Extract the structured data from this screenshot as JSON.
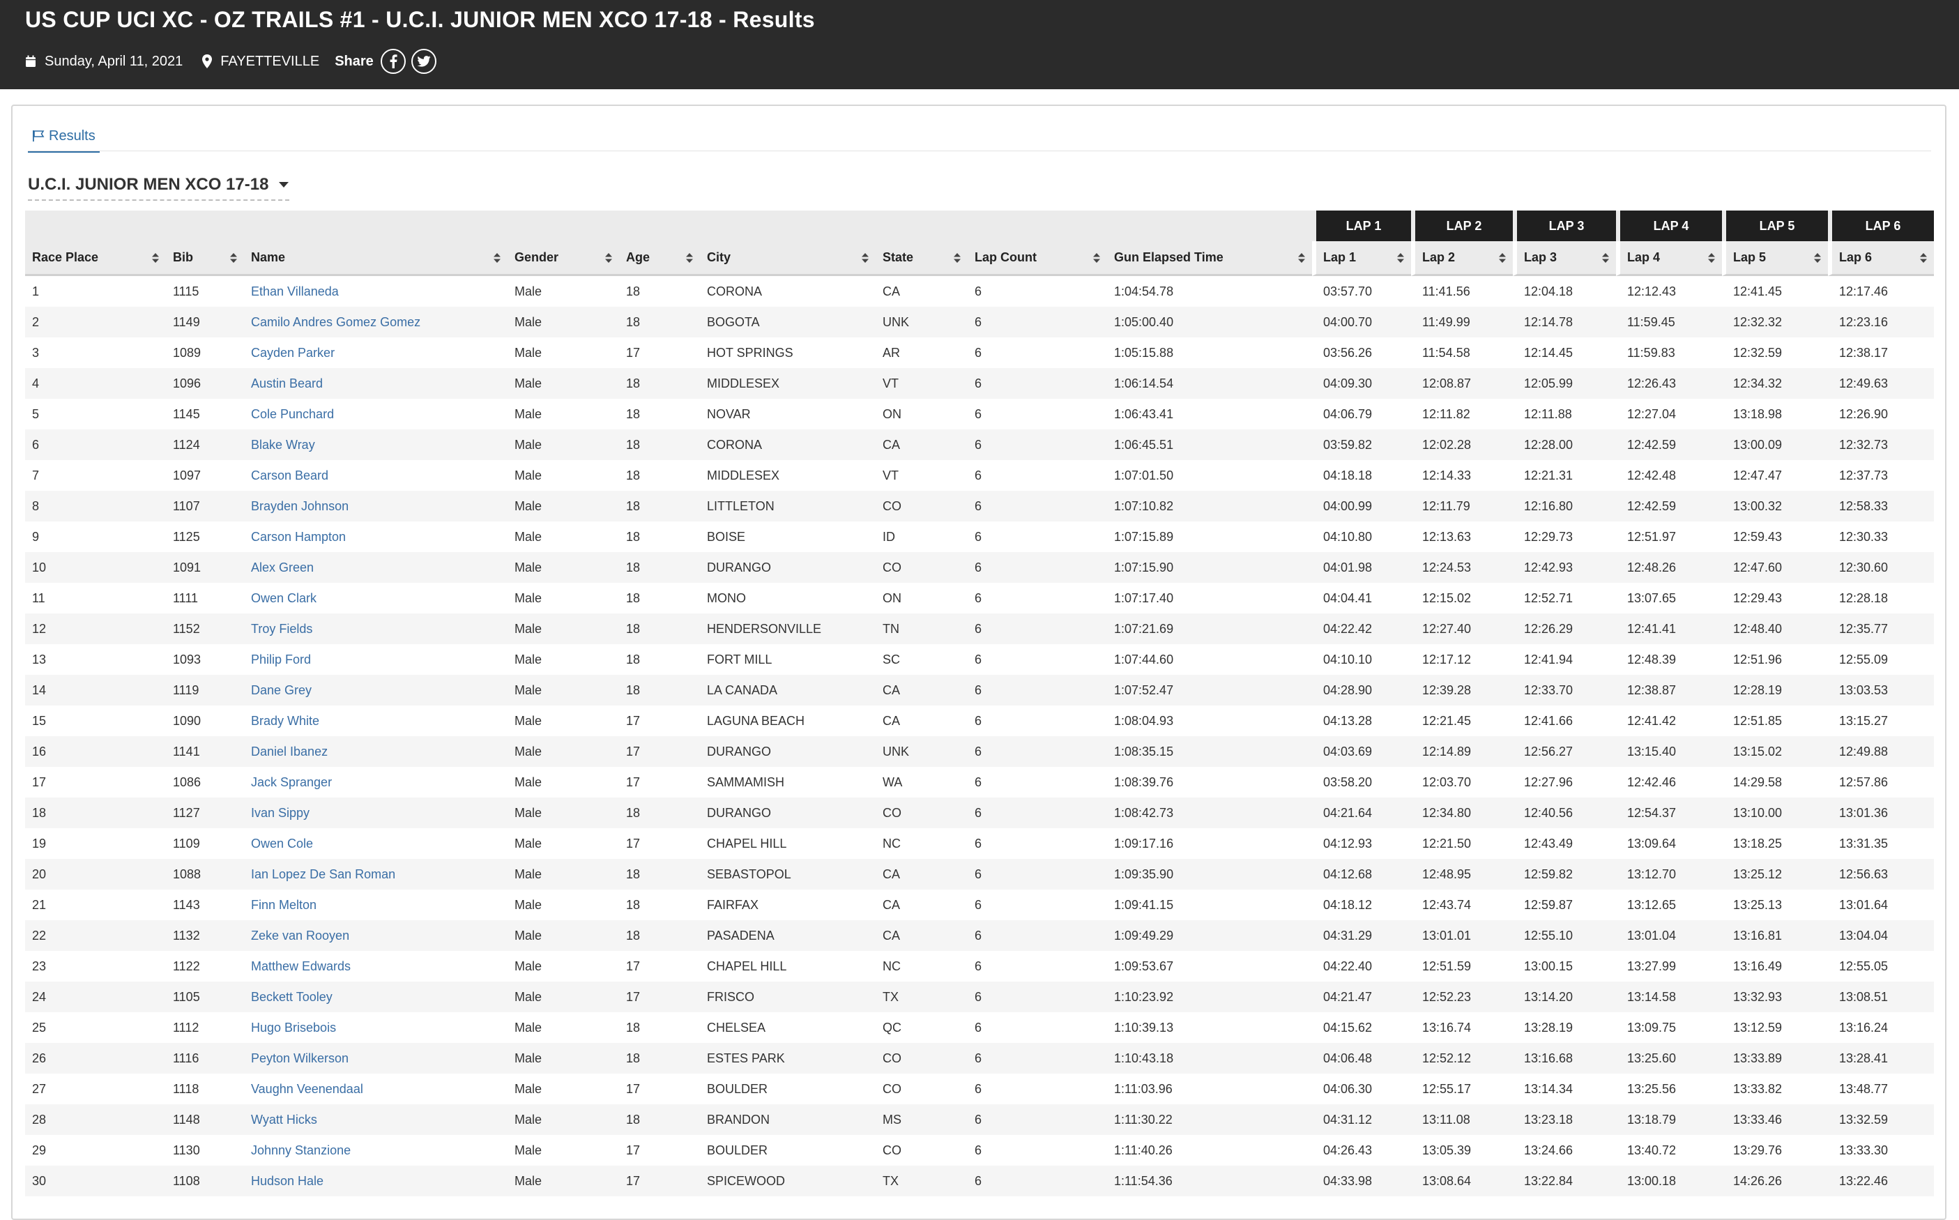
{
  "header": {
    "title": "US CUP UCI XC - OZ TRAILS #1 - U.C.I. JUNIOR MEN XCO 17-18 - Results",
    "date": "Sunday, April 11, 2021",
    "location": "FAYETTEVILLE",
    "share_label": "Share"
  },
  "tabs": [
    {
      "label": "Results"
    }
  ],
  "category": {
    "selected": "U.C.I. JUNIOR MEN XCO 17-18"
  },
  "table": {
    "lap_groups": [
      "LAP 1",
      "LAP 2",
      "LAP 3",
      "LAP 4",
      "LAP 5",
      "LAP 6"
    ],
    "columns": [
      "Race Place",
      "Bib",
      "Name",
      "Gender",
      "Age",
      "City",
      "State",
      "Lap Count",
      "Gun Elapsed Time",
      "Lap 1",
      "Lap 2",
      "Lap 3",
      "Lap 4",
      "Lap 5",
      "Lap 6"
    ],
    "rows": [
      [
        "1",
        "1115",
        "Ethan Villaneda",
        "Male",
        "18",
        "CORONA",
        "CA",
        "6",
        "1:04:54.78",
        "03:57.70",
        "11:41.56",
        "12:04.18",
        "12:12.43",
        "12:41.45",
        "12:17.46"
      ],
      [
        "2",
        "1149",
        "Camilo Andres Gomez Gomez",
        "Male",
        "18",
        "BOGOTA",
        "UNK",
        "6",
        "1:05:00.40",
        "04:00.70",
        "11:49.99",
        "12:14.78",
        "11:59.45",
        "12:32.32",
        "12:23.16"
      ],
      [
        "3",
        "1089",
        "Cayden Parker",
        "Male",
        "17",
        "HOT SPRINGS",
        "AR",
        "6",
        "1:05:15.88",
        "03:56.26",
        "11:54.58",
        "12:14.45",
        "11:59.83",
        "12:32.59",
        "12:38.17"
      ],
      [
        "4",
        "1096",
        "Austin Beard",
        "Male",
        "18",
        "MIDDLESEX",
        "VT",
        "6",
        "1:06:14.54",
        "04:09.30",
        "12:08.87",
        "12:05.99",
        "12:26.43",
        "12:34.32",
        "12:49.63"
      ],
      [
        "5",
        "1145",
        "Cole Punchard",
        "Male",
        "18",
        "NOVAR",
        "ON",
        "6",
        "1:06:43.41",
        "04:06.79",
        "12:11.82",
        "12:11.88",
        "12:27.04",
        "13:18.98",
        "12:26.90"
      ],
      [
        "6",
        "1124",
        "Blake Wray",
        "Male",
        "18",
        "CORONA",
        "CA",
        "6",
        "1:06:45.51",
        "03:59.82",
        "12:02.28",
        "12:28.00",
        "12:42.59",
        "13:00.09",
        "12:32.73"
      ],
      [
        "7",
        "1097",
        "Carson Beard",
        "Male",
        "18",
        "MIDDLESEX",
        "VT",
        "6",
        "1:07:01.50",
        "04:18.18",
        "12:14.33",
        "12:21.31",
        "12:42.48",
        "12:47.47",
        "12:37.73"
      ],
      [
        "8",
        "1107",
        "Brayden Johnson",
        "Male",
        "18",
        "LITTLETON",
        "CO",
        "6",
        "1:07:10.82",
        "04:00.99",
        "12:11.79",
        "12:16.80",
        "12:42.59",
        "13:00.32",
        "12:58.33"
      ],
      [
        "9",
        "1125",
        "Carson Hampton",
        "Male",
        "18",
        "BOISE",
        "ID",
        "6",
        "1:07:15.89",
        "04:10.80",
        "12:13.63",
        "12:29.73",
        "12:51.97",
        "12:59.43",
        "12:30.33"
      ],
      [
        "10",
        "1091",
        "Alex Green",
        "Male",
        "18",
        "DURANGO",
        "CO",
        "6",
        "1:07:15.90",
        "04:01.98",
        "12:24.53",
        "12:42.93",
        "12:48.26",
        "12:47.60",
        "12:30.60"
      ],
      [
        "11",
        "1111",
        "Owen Clark",
        "Male",
        "18",
        "MONO",
        "ON",
        "6",
        "1:07:17.40",
        "04:04.41",
        "12:15.02",
        "12:52.71",
        "13:07.65",
        "12:29.43",
        "12:28.18"
      ],
      [
        "12",
        "1152",
        "Troy Fields",
        "Male",
        "18",
        "HENDERSONVILLE",
        "TN",
        "6",
        "1:07:21.69",
        "04:22.42",
        "12:27.40",
        "12:26.29",
        "12:41.41",
        "12:48.40",
        "12:35.77"
      ],
      [
        "13",
        "1093",
        "Philip Ford",
        "Male",
        "18",
        "FORT MILL",
        "SC",
        "6",
        "1:07:44.60",
        "04:10.10",
        "12:17.12",
        "12:41.94",
        "12:48.39",
        "12:51.96",
        "12:55.09"
      ],
      [
        "14",
        "1119",
        "Dane Grey",
        "Male",
        "18",
        "LA CANADA",
        "CA",
        "6",
        "1:07:52.47",
        "04:28.90",
        "12:39.28",
        "12:33.70",
        "12:38.87",
        "12:28.19",
        "13:03.53"
      ],
      [
        "15",
        "1090",
        "Brady White",
        "Male",
        "17",
        "LAGUNA BEACH",
        "CA",
        "6",
        "1:08:04.93",
        "04:13.28",
        "12:21.45",
        "12:41.66",
        "12:41.42",
        "12:51.85",
        "13:15.27"
      ],
      [
        "16",
        "1141",
        "Daniel Ibanez",
        "Male",
        "17",
        "DURANGO",
        "UNK",
        "6",
        "1:08:35.15",
        "04:03.69",
        "12:14.89",
        "12:56.27",
        "13:15.40",
        "13:15.02",
        "12:49.88"
      ],
      [
        "17",
        "1086",
        "Jack Spranger",
        "Male",
        "17",
        "SAMMAMISH",
        "WA",
        "6",
        "1:08:39.76",
        "03:58.20",
        "12:03.70",
        "12:27.96",
        "12:42.46",
        "14:29.58",
        "12:57.86"
      ],
      [
        "18",
        "1127",
        "Ivan Sippy",
        "Male",
        "18",
        "DURANGO",
        "CO",
        "6",
        "1:08:42.73",
        "04:21.64",
        "12:34.80",
        "12:40.56",
        "12:54.37",
        "13:10.00",
        "13:01.36"
      ],
      [
        "19",
        "1109",
        "Owen Cole",
        "Male",
        "17",
        "CHAPEL HILL",
        "NC",
        "6",
        "1:09:17.16",
        "04:12.93",
        "12:21.50",
        "12:43.49",
        "13:09.64",
        "13:18.25",
        "13:31.35"
      ],
      [
        "20",
        "1088",
        "Ian Lopez De San Roman",
        "Male",
        "18",
        "SEBASTOPOL",
        "CA",
        "6",
        "1:09:35.90",
        "04:12.68",
        "12:48.95",
        "12:59.82",
        "13:12.70",
        "13:25.12",
        "12:56.63"
      ],
      [
        "21",
        "1143",
        "Finn Melton",
        "Male",
        "18",
        "FAIRFAX",
        "CA",
        "6",
        "1:09:41.15",
        "04:18.12",
        "12:43.74",
        "12:59.87",
        "13:12.65",
        "13:25.13",
        "13:01.64"
      ],
      [
        "22",
        "1132",
        "Zeke van Rooyen",
        "Male",
        "18",
        "PASADENA",
        "CA",
        "6",
        "1:09:49.29",
        "04:31.29",
        "13:01.01",
        "12:55.10",
        "13:01.04",
        "13:16.81",
        "13:04.04"
      ],
      [
        "23",
        "1122",
        "Matthew Edwards",
        "Male",
        "17",
        "CHAPEL HILL",
        "NC",
        "6",
        "1:09:53.67",
        "04:22.40",
        "12:51.59",
        "13:00.15",
        "13:27.99",
        "13:16.49",
        "12:55.05"
      ],
      [
        "24",
        "1105",
        "Beckett Tooley",
        "Male",
        "17",
        "FRISCO",
        "TX",
        "6",
        "1:10:23.92",
        "04:21.47",
        "12:52.23",
        "13:14.20",
        "13:14.58",
        "13:32.93",
        "13:08.51"
      ],
      [
        "25",
        "1112",
        "Hugo Brisebois",
        "Male",
        "18",
        "CHELSEA",
        "QC",
        "6",
        "1:10:39.13",
        "04:15.62",
        "13:16.74",
        "13:28.19",
        "13:09.75",
        "13:12.59",
        "13:16.24"
      ],
      [
        "26",
        "1116",
        "Peyton Wilkerson",
        "Male",
        "18",
        "ESTES PARK",
        "CO",
        "6",
        "1:10:43.18",
        "04:06.48",
        "12:52.12",
        "13:16.68",
        "13:25.60",
        "13:33.89",
        "13:28.41"
      ],
      [
        "27",
        "1118",
        "Vaughn Veenendaal",
        "Male",
        "17",
        "BOULDER",
        "CO",
        "6",
        "1:11:03.96",
        "04:06.30",
        "12:55.17",
        "13:14.34",
        "13:25.56",
        "13:33.82",
        "13:48.77"
      ],
      [
        "28",
        "1148",
        "Wyatt Hicks",
        "Male",
        "18",
        "BRANDON",
        "MS",
        "6",
        "1:11:30.22",
        "04:31.12",
        "13:11.08",
        "13:23.18",
        "13:18.79",
        "13:33.46",
        "13:32.59"
      ],
      [
        "29",
        "1130",
        "Johnny Stanzione",
        "Male",
        "17",
        "BOULDER",
        "CO",
        "6",
        "1:11:40.26",
        "04:26.43",
        "13:05.39",
        "13:24.66",
        "13:40.72",
        "13:29.76",
        "13:33.30"
      ],
      [
        "30",
        "1108",
        "Hudson Hale",
        "Male",
        "17",
        "SPICEWOOD",
        "TX",
        "6",
        "1:11:54.36",
        "04:33.98",
        "13:08.64",
        "13:22.84",
        "13:00.18",
        "14:26.26",
        "13:22.46"
      ]
    ]
  },
  "colors": {
    "topbar": "#2b2b2b",
    "link": "#3a6ea5",
    "tab_accent": "#2e6da4",
    "lap_header": "#1f1f1f",
    "header_bg": "#ebebeb"
  },
  "icons": {
    "date": "calendar-icon",
    "location": "map-pin-icon",
    "facebook": "facebook-icon",
    "twitter": "twitter-icon",
    "tab": "flag-icon",
    "dropdown": "caret-down-icon",
    "sort": "sort-icon"
  }
}
